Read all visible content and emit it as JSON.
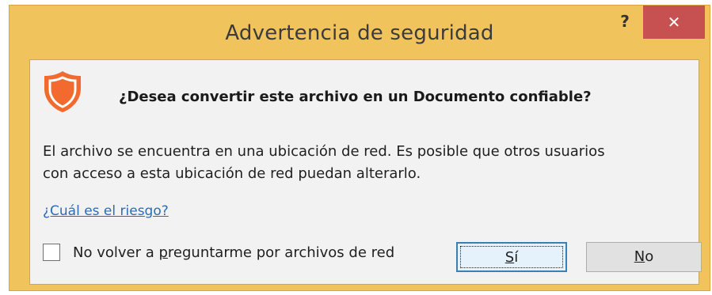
{
  "dialog": {
    "title": "Advertencia de seguridad",
    "help_label": "?",
    "close_label": "✕",
    "accent_title_bar": "#f1c35c",
    "close_color": "#c75050"
  },
  "content": {
    "icon": "shield-icon",
    "icon_color": "#f26a2e",
    "question": "¿Desea convertir este archivo en un Documento confiable?",
    "message_line1": "El archivo se encuentra en una ubicación de red. Es posible que otros usuarios",
    "message_line2": "con acceso a esta ubicación de red puedan alterarlo.",
    "risk_link": "¿Cuál es el riesgo?",
    "checkbox": {
      "label_pre": "No volver a ",
      "label_mnemonic": "p",
      "label_post": "reguntarme por archivos de red",
      "checked": false
    }
  },
  "buttons": {
    "yes": {
      "mnemonic": "S",
      "rest": "í"
    },
    "no": {
      "mnemonic": "N",
      "rest": "o"
    }
  }
}
